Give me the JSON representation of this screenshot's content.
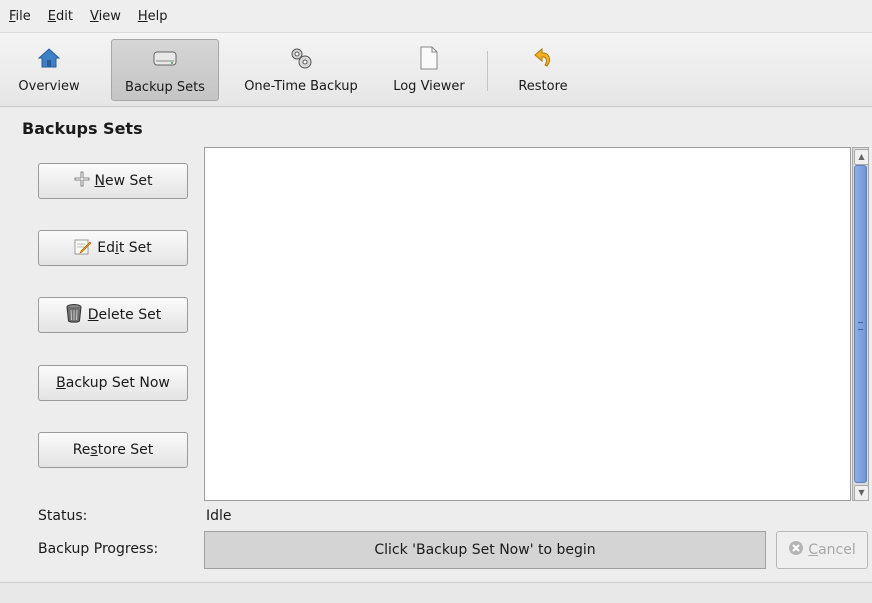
{
  "menu": [
    {
      "mnemonic": "F",
      "rest": "ile"
    },
    {
      "mnemonic": "E",
      "rest": "dit"
    },
    {
      "mnemonic": "V",
      "rest": "iew"
    },
    {
      "mnemonic": "H",
      "rest": "elp"
    }
  ],
  "toolbar": {
    "overview": {
      "label": "Overview",
      "icon": "home-icon"
    },
    "backup_sets": {
      "label": "Backup Sets",
      "icon": "drive-icon",
      "active": true
    },
    "one_time_backup": {
      "label": "One-Time Backup",
      "icon": "gears-icon"
    },
    "log_viewer": {
      "label": "Log Viewer",
      "icon": "document-icon"
    },
    "restore": {
      "label": "Restore",
      "icon": "restore-arrow-icon"
    }
  },
  "section_title": "Backups Sets",
  "side_buttons": {
    "new_set": {
      "pre": "",
      "mnemonic": "N",
      "post": "ew Set",
      "icon": "plus-icon"
    },
    "edit_set": {
      "pre": "Ed",
      "mnemonic": "i",
      "post": "t Set",
      "icon": "edit-icon"
    },
    "delete_set": {
      "pre": "",
      "mnemonic": "D",
      "post": "elete Set",
      "icon": "trash-icon"
    },
    "backup_now": {
      "pre": "",
      "mnemonic": "B",
      "post": "ackup Set Now"
    },
    "restore_set": {
      "pre": "Re",
      "mnemonic": "s",
      "post": "tore Set"
    }
  },
  "status": {
    "label": "Status:",
    "value": "Idle"
  },
  "progress": {
    "label": "Backup Progress:",
    "text": "Click 'Backup Set Now' to begin"
  },
  "cancel": {
    "pre": "",
    "mnemonic": "C",
    "post": "ancel",
    "enabled": false
  },
  "colors": {
    "scroll_thumb": "#7a9edd",
    "active_tool": "#cbcbcb"
  }
}
